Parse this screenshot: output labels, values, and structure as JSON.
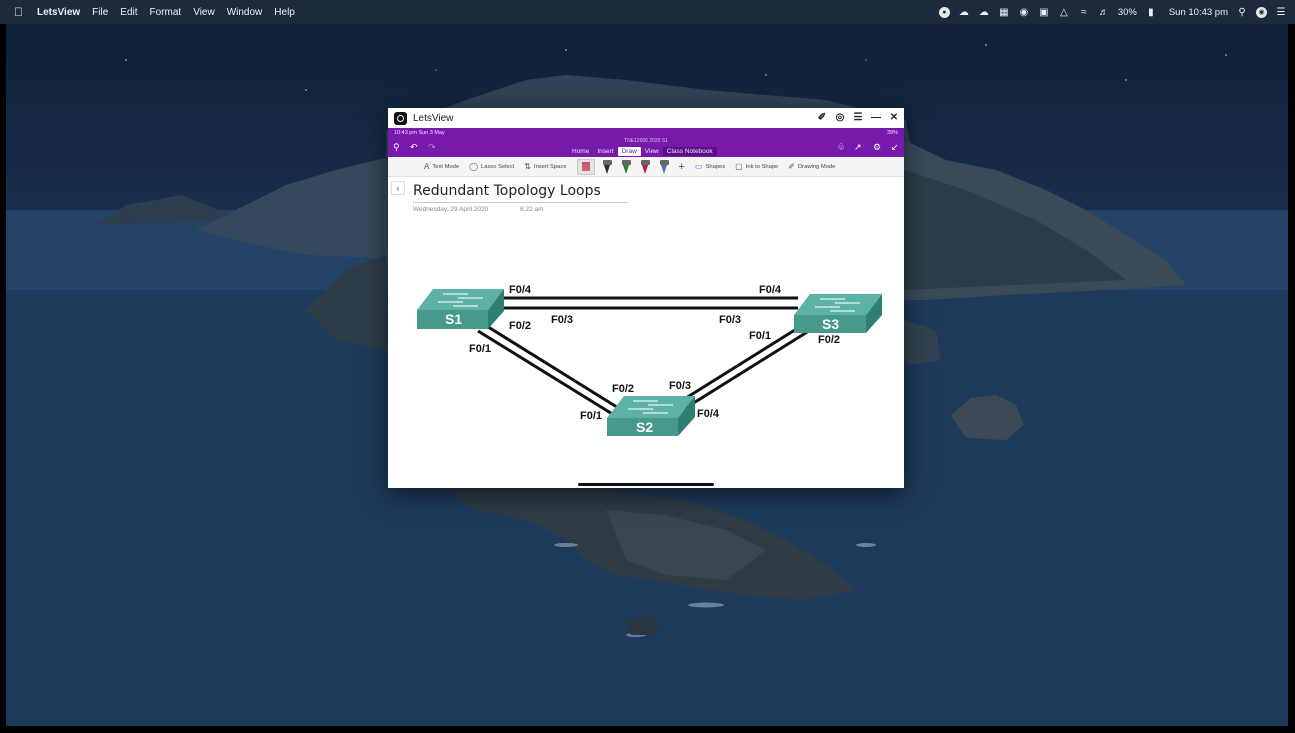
{
  "menubar": {
    "app_name": "LetsView",
    "menus": [
      "File",
      "Edit",
      "Format",
      "View",
      "Window",
      "Help"
    ],
    "battery": "30%",
    "clock": "Sun 10:43 pm"
  },
  "window": {
    "title": "LetsView"
  },
  "ipad": {
    "time": "10:43 pm  Sun 3 May",
    "battery": "39%"
  },
  "onenote": {
    "notebook": "TNE12006 2020 S1",
    "tabs": [
      "Home",
      "Insert",
      "Draw",
      "View",
      "Class Notebook"
    ],
    "active_tab": "Draw",
    "toolbar": {
      "text_mode": "Text Mode",
      "lasso_select": "Lasso Select",
      "insert_space": "Insert Space",
      "shapes": "Shapes",
      "ink_to_shape": "Ink to Shape",
      "drawing_mode": "Drawing Mode"
    },
    "pens": [
      {
        "name": "pen-dark",
        "color": "#2b2b2b"
      },
      {
        "name": "pen-green",
        "color": "#2a7a3a"
      },
      {
        "name": "pen-red",
        "color": "#b0203a"
      },
      {
        "name": "highlighter",
        "color": "#5a6aa8"
      }
    ]
  },
  "page": {
    "title": "Redundant Topology Loops",
    "date": "Wednesday, 29 April 2020",
    "time": "8:22 am"
  },
  "diagram": {
    "switches": [
      "S1",
      "S2",
      "S3"
    ],
    "ports": {
      "s1_f04": "F0/4",
      "s1_f03": "F0/3",
      "s1_f02": "F0/2",
      "s1_f01": "F0/1",
      "s3_f04": "F0/4",
      "s3_f03": "F0/3",
      "s3_f01": "F0/1",
      "s3_f02": "F0/2",
      "s2_f02": "F0/2",
      "s2_f01": "F0/1",
      "s2_f03": "F0/3",
      "s2_f04": "F0/4"
    }
  }
}
